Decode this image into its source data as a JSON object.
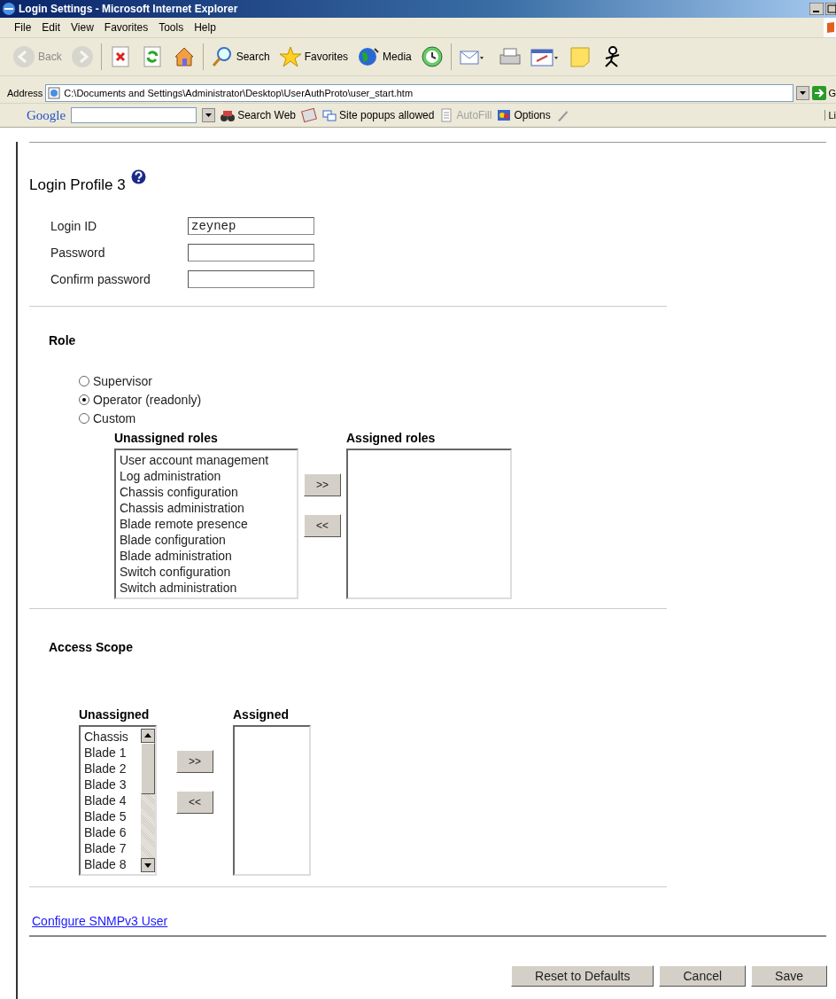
{
  "window": {
    "title": "Login Settings - Microsoft Internet Explorer"
  },
  "menu": [
    "File",
    "Edit",
    "View",
    "Favorites",
    "Tools",
    "Help"
  ],
  "toolbar": [
    {
      "kind": "back",
      "label": "Back",
      "disabled": true
    },
    {
      "kind": "forward",
      "disabled": true
    },
    {
      "kind": "stop",
      "disabled": false
    },
    {
      "kind": "refresh",
      "disabled": false
    },
    {
      "kind": "home",
      "disabled": false
    },
    {
      "kind": "search",
      "label": "Search",
      "disabled": false
    },
    {
      "kind": "favorites",
      "label": "Favorites",
      "disabled": false
    },
    {
      "kind": "media",
      "label": "Media",
      "disabled": false
    },
    {
      "kind": "history",
      "disabled": false
    },
    {
      "kind": "mail",
      "disabled": false
    },
    {
      "kind": "print",
      "disabled": false
    },
    {
      "kind": "edit",
      "disabled": false
    },
    {
      "kind": "note",
      "disabled": false
    },
    {
      "kind": "messenger",
      "disabled": false
    }
  ],
  "address": {
    "label": "Address",
    "value": "C:\\Documents and Settings\\Administrator\\Desktop\\UserAuthProto\\user_start.htm",
    "go": "G"
  },
  "google_bar": {
    "logo": "Google",
    "search_web": "Search Web",
    "popups": "Site popups allowed",
    "autofill": "AutoFill",
    "autofill_disabled": true,
    "options": "Options",
    "links": "Li"
  },
  "page": {
    "title": "Login Profile 3",
    "fields": [
      {
        "label": "Login ID",
        "value": "zeynep"
      },
      {
        "label": "Password"
      },
      {
        "label": "Confirm password"
      }
    ],
    "role": {
      "heading": "Role",
      "options": [
        {
          "label": "Supervisor",
          "selected": false
        },
        {
          "label": "Operator (readonly)",
          "selected": true
        },
        {
          "label": "Custom",
          "selected": false
        }
      ],
      "unassigned_heading": "Unassigned roles",
      "assigned_heading": "Assigned roles",
      "unassigned": [
        "User account management",
        "Log administration",
        "Chassis configuration",
        "Chassis administration",
        "Blade remote presence",
        "Blade configuration",
        "Blade administration",
        "Switch configuration",
        "Switch administration"
      ],
      "add": ">>",
      "remove": "<<"
    },
    "scope": {
      "heading": "Access Scope",
      "unassigned_heading": "Unassigned",
      "assigned_heading": "Assigned",
      "unassigned": [
        "Chassis",
        "Blade 1",
        "Blade 2",
        "Blade 3",
        "Blade 4",
        "Blade 5",
        "Blade 6",
        "Blade 7",
        "Blade 8"
      ],
      "add": ">>",
      "remove": "<<"
    },
    "link": "Configure SNMPv3 User",
    "buttons": [
      "Reset to Defaults",
      "Cancel",
      "Save"
    ]
  }
}
